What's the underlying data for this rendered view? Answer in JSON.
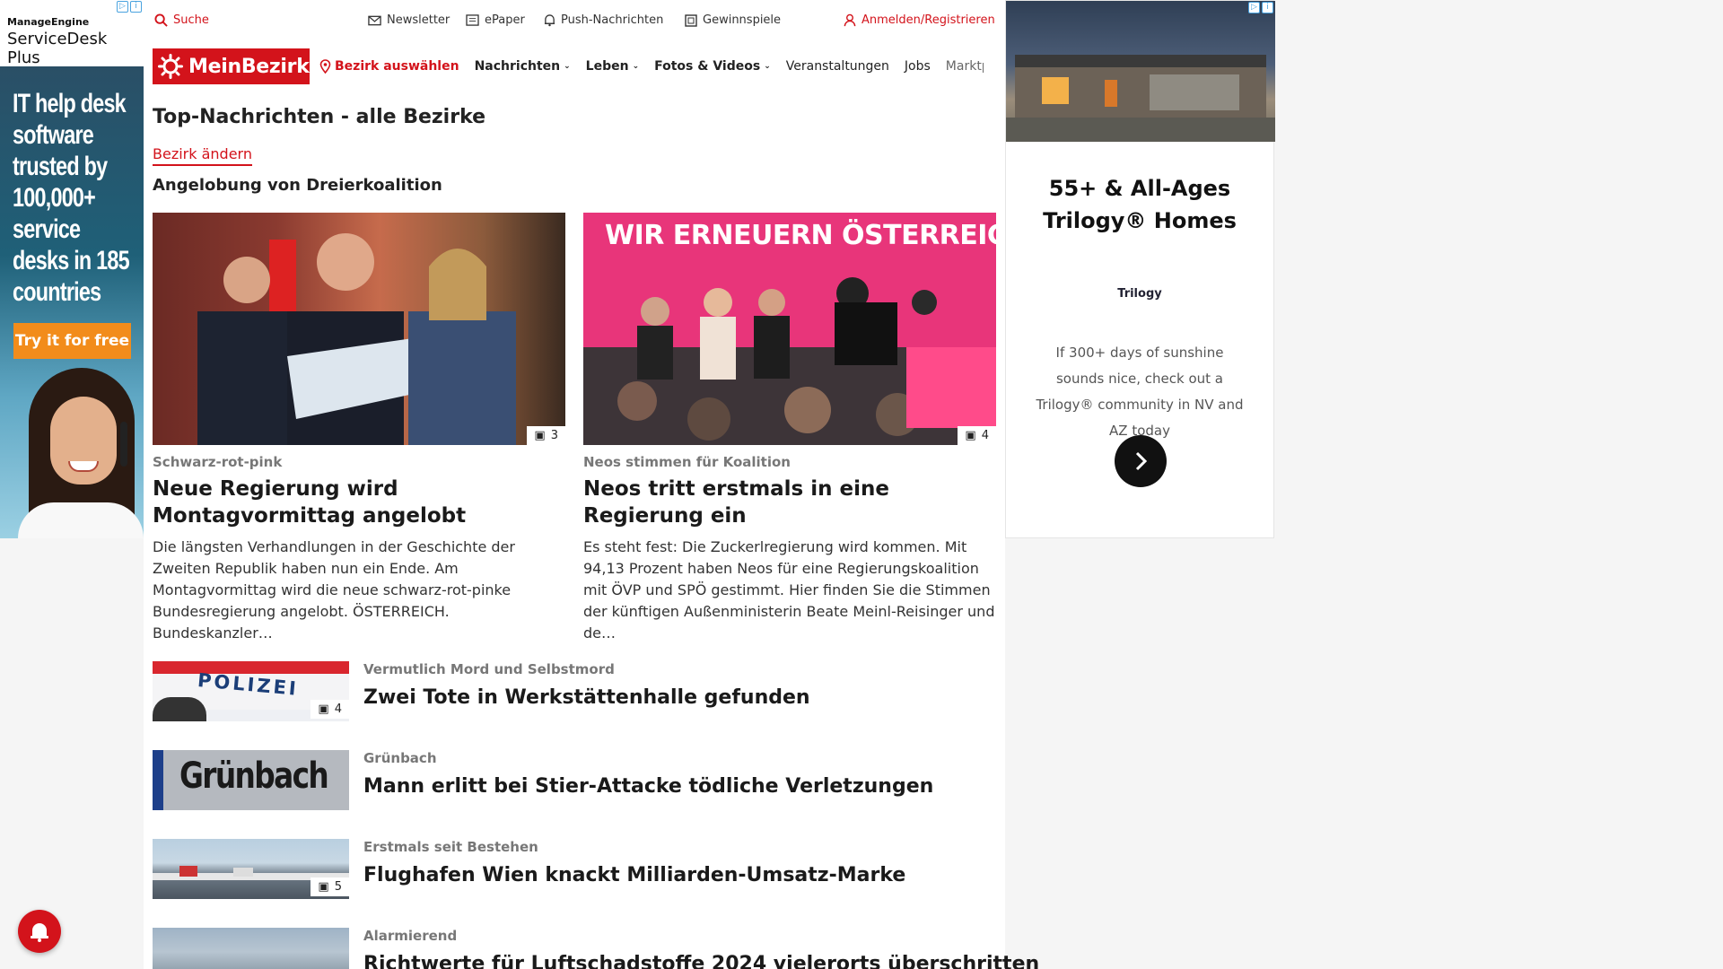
{
  "left_ad": {
    "brand_top": "ManageEngine",
    "brand_product": "ServiceDesk Plus",
    "headline": "IT help desk software trusted by 100,000+ service desks in 185 countries",
    "cta": "Try it for free"
  },
  "topbar": {
    "search": "Suche",
    "newsletter": "Newsletter",
    "epaper": "ePaper",
    "push": "Push-Nachrichten",
    "games": "Gewinnspiele",
    "login": "Anmelden/Registrieren"
  },
  "nav": {
    "logo": "MeinBezirk",
    "district": "Bezirk auswählen",
    "news": "Nachrichten",
    "life": "Leben",
    "photos": "Fotos & Videos",
    "events": "Veranstaltungen",
    "jobs": "Jobs",
    "market": "Marktplatz"
  },
  "page": {
    "title": "Top-Nachrichten - alle Bezirke",
    "change_district": "Bezirk ändern",
    "topic": "Angelobung von Dreierkoalition"
  },
  "cards": [
    {
      "category": "Schwarz-rot-pink",
      "title": "Neue Regierung wird Montagvormittag angelobt",
      "text": "Die längsten Verhandlungen in der Geschichte der Zweiten Republik haben nun ein Ende. Am Montagvormittag wird die neue schwarz-rot-pinke Bundesregierung angelobt. ÖSTERREICH. Bundeskanzler…",
      "photo_count": "3"
    },
    {
      "category": "Neos stimmen für Koalition",
      "title": "Neos tritt erstmals in eine Regierung ein",
      "text": "Es steht fest: Die Zuckerlregierung wird kommen. Mit 94,13 Prozent haben Neos für eine Regierungskoalition mit ÖVP und SPÖ gestimmt. Hier finden Sie die Stimmen der künftigen Außenministerin Beate Meinl-Reisinger und de…",
      "photo_count": "4",
      "image_banner": "WIR ERNEUERN ÖSTERREICH"
    }
  ],
  "rows": [
    {
      "category": "Vermutlich Mord und Selbstmord",
      "title": "Zwei Tote in Werkstättenhalle gefunden",
      "photo_count": "4",
      "thumb_text": "POLIZEI"
    },
    {
      "category": "Grünbach",
      "title": "Mann erlitt bei Stier-Attacke tödliche Verletzungen",
      "thumb_text": "Grünbach"
    },
    {
      "category": "Erstmals seit Bestehen",
      "title": "Flughafen Wien knackt Milliarden-Umsatz-Marke",
      "photo_count": "5"
    },
    {
      "category": "Alarmierend",
      "title": "Richtwerte für Luftschadstoffe 2024 vielerorts überschritten"
    }
  ],
  "right_ad": {
    "headline": "55+ & All-Ages Trilogy® Homes",
    "logo": "Trilogy",
    "description": "If 300+ days of sunshine sounds nice, check out a Trilogy® community in NV and AZ today"
  },
  "colors": {
    "brand_red": "#d3131b"
  }
}
